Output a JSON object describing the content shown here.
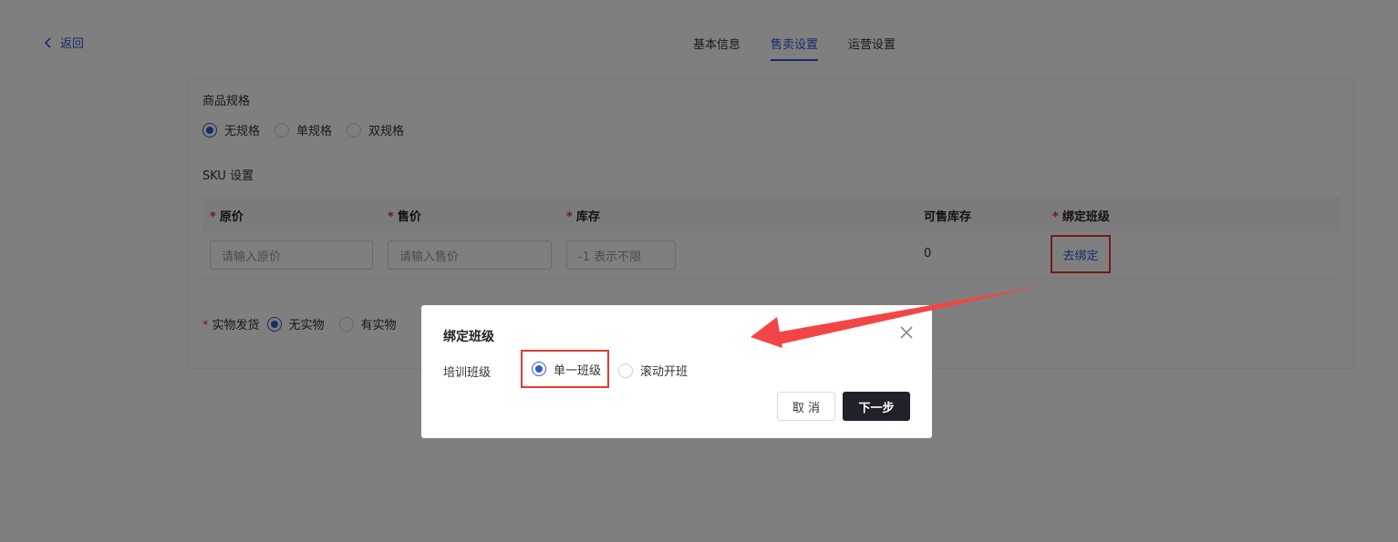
{
  "header": {
    "back_label": "返回",
    "tabs": [
      {
        "label": "基本信息",
        "active": false
      },
      {
        "label": "售卖设置",
        "active": true
      },
      {
        "label": "运营设置",
        "active": false
      }
    ]
  },
  "spec": {
    "title": "商品规格",
    "options": [
      {
        "label": "无规格",
        "checked": true
      },
      {
        "label": "单规格",
        "checked": false
      },
      {
        "label": "双规格",
        "checked": false
      }
    ]
  },
  "sku": {
    "title": "SKU 设置",
    "columns": [
      "原价",
      "售价",
      "库存",
      "可售库存",
      "绑定班级"
    ],
    "required_columns": [
      true,
      true,
      true,
      false,
      true
    ],
    "placeholders": {
      "original_price": "请输入原价",
      "sale_price": "请输入售价",
      "stock": "-1 表示不限"
    },
    "sellable_stock": "0",
    "bind_label": "去绑定"
  },
  "shipping": {
    "label": "实物发货",
    "options": [
      {
        "label": "无实物",
        "checked": true
      },
      {
        "label": "有实物",
        "checked": false
      }
    ]
  },
  "modal": {
    "title": "绑定班级",
    "field_label": "培训班级",
    "options": [
      {
        "label": "单一班级",
        "checked": true
      },
      {
        "label": "滚动开班",
        "checked": false
      }
    ],
    "cancel_label": "取 消",
    "next_label": "下一步"
  },
  "colors": {
    "accent": "#2f5bd3",
    "highlight": "#e53935",
    "primary_button": "#1f2228"
  },
  "icons": [
    "chevron-left-icon",
    "close-icon",
    "annotation-arrow"
  ]
}
